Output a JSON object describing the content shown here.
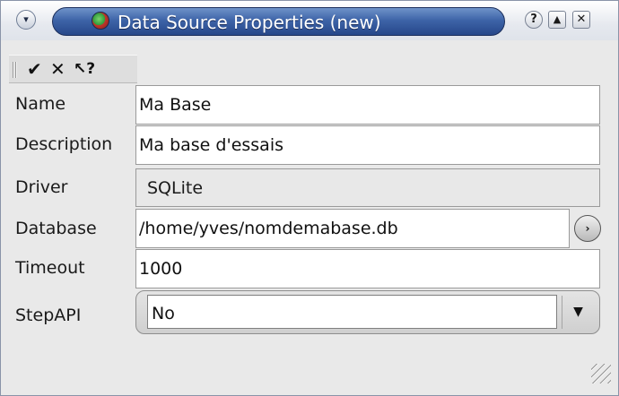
{
  "window": {
    "title": "Data Source Properties (new)",
    "controls": {
      "menu": "▾",
      "help": "?",
      "shade": "▲",
      "close": "✕"
    }
  },
  "toolbar": {
    "ok": "✔",
    "cancel": "✕",
    "whats_this": "↖?"
  },
  "form": {
    "name_label": "Name",
    "name_value": "Ma Base",
    "description_label": "Description",
    "description_value": "Ma base d'essais",
    "driver_label": "Driver",
    "driver_value": "SQLite",
    "database_label": "Database",
    "database_value": "/home/yves/nomdemabase.db",
    "timeout_label": "Timeout",
    "timeout_value": "1000",
    "stepapi_label": "StepAPI",
    "stepapi_value": "No"
  },
  "glyphs": {
    "browse": "›",
    "dropdown": "▼"
  }
}
